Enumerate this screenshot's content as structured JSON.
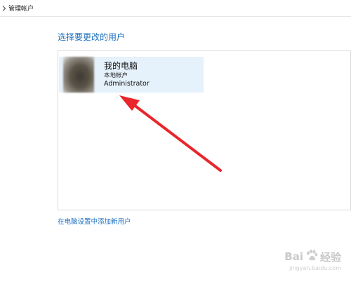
{
  "breadcrumb": {
    "label": "管理帐户"
  },
  "heading": "选择要更改的用户",
  "user": {
    "name": "我的电脑",
    "account_type": "本地帐户",
    "role": "Administrator"
  },
  "add_user_link": "在电脑设置中添加新用户",
  "annotation": {
    "arrow_color": "#e8262b"
  },
  "watermark": {
    "brand_left": "Bai",
    "brand_right": "经验",
    "url": "jingyan.baidu.com"
  }
}
